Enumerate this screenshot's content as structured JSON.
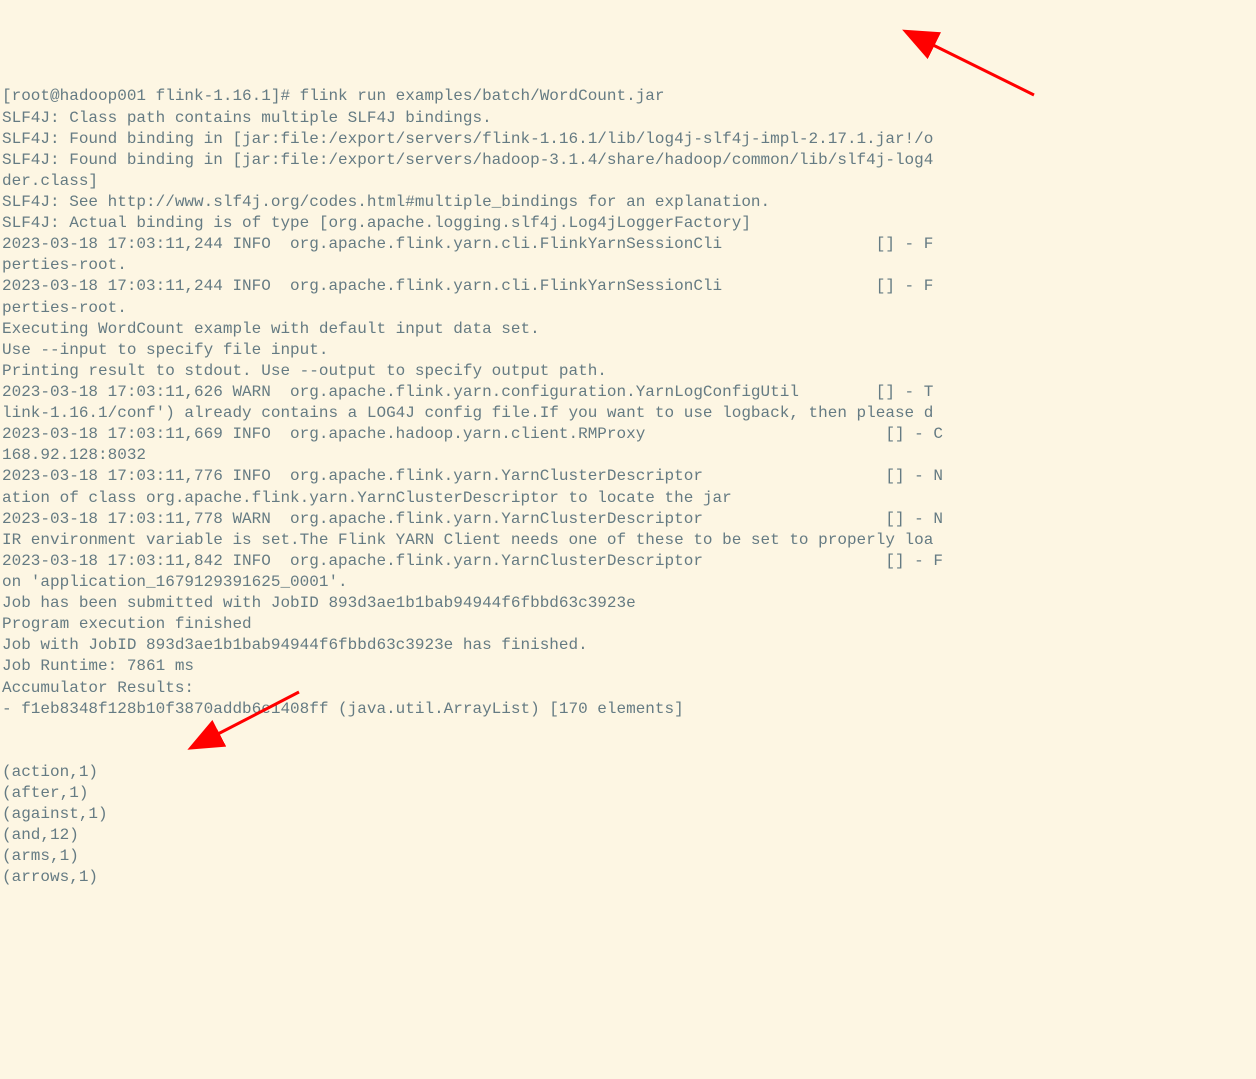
{
  "terminal": {
    "lines": [
      "[root@hadoop001 flink-1.16.1]# flink run examples/batch/WordCount.jar",
      "SLF4J: Class path contains multiple SLF4J bindings.",
      "SLF4J: Found binding in [jar:file:/export/servers/flink-1.16.1/lib/log4j-slf4j-impl-2.17.1.jar!/o",
      "SLF4J: Found binding in [jar:file:/export/servers/hadoop-3.1.4/share/hadoop/common/lib/slf4j-log4",
      "der.class]",
      "SLF4J: See http://www.slf4j.org/codes.html#multiple_bindings for an explanation.",
      "SLF4J: Actual binding is of type [org.apache.logging.slf4j.Log4jLoggerFactory]",
      "2023-03-18 17:03:11,244 INFO  org.apache.flink.yarn.cli.FlinkYarnSessionCli                [] - F",
      "perties-root.",
      "2023-03-18 17:03:11,244 INFO  org.apache.flink.yarn.cli.FlinkYarnSessionCli                [] - F",
      "perties-root.",
      "Executing WordCount example with default input data set.",
      "Use --input to specify file input.",
      "Printing result to stdout. Use --output to specify output path.",
      "2023-03-18 17:03:11,626 WARN  org.apache.flink.yarn.configuration.YarnLogConfigUtil        [] - T",
      "link-1.16.1/conf') already contains a LOG4J config file.If you want to use logback, then please d",
      "2023-03-18 17:03:11,669 INFO  org.apache.hadoop.yarn.client.RMProxy                         [] - C",
      "168.92.128:8032",
      "2023-03-18 17:03:11,776 INFO  org.apache.flink.yarn.YarnClusterDescriptor                   [] - N",
      "ation of class org.apache.flink.yarn.YarnClusterDescriptor to locate the jar",
      "2023-03-18 17:03:11,778 WARN  org.apache.flink.yarn.YarnClusterDescriptor                   [] - N",
      "IR environment variable is set.The Flink YARN Client needs one of these to be set to properly loa",
      "2023-03-18 17:03:11,842 INFO  org.apache.flink.yarn.YarnClusterDescriptor                   [] - F",
      "on 'application_1679129391625_0001'.",
      "Job has been submitted with JobID 893d3ae1b1bab94944f6fbbd63c3923e",
      "Program execution finished",
      "Job with JobID 893d3ae1b1bab94944f6fbbd63c3923e has finished.",
      "Job Runtime: 7861 ms",
      "Accumulator Results:",
      "- f1eb8348f128b10f3870addb6e1408ff (java.util.ArrayList) [170 elements]",
      "",
      "",
      "(action,1)",
      "(after,1)",
      "(against,1)",
      "(and,12)",
      "(arms,1)",
      "(arrows,1)"
    ]
  },
  "annotations": {
    "arrow_color": "#ff0000"
  }
}
